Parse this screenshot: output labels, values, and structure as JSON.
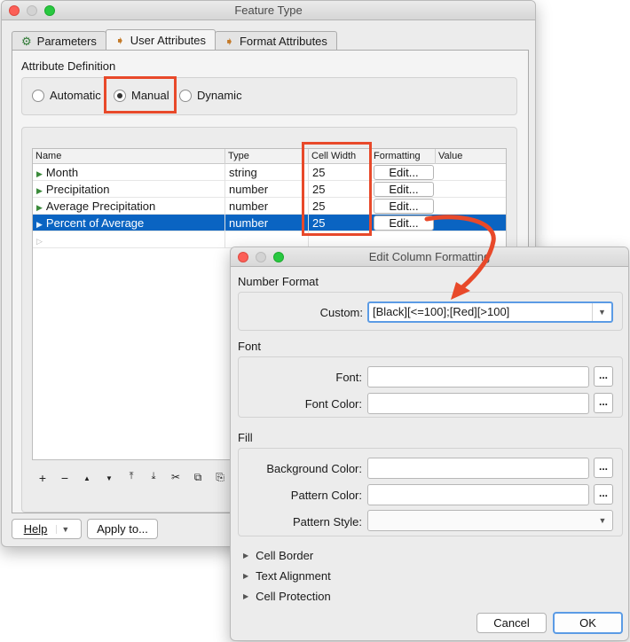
{
  "main_window": {
    "title": "Feature Type",
    "tabs": [
      {
        "label": "Parameters",
        "icon": "gear-icon"
      },
      {
        "label": "User Attributes",
        "icon": "arrow-icon",
        "active": true
      },
      {
        "label": "Format Attributes",
        "icon": "arrow-icon"
      }
    ],
    "attribute_definition_label": "Attribute Definition",
    "radios": [
      {
        "label": "Automatic",
        "checked": false
      },
      {
        "label": "Manual",
        "checked": true
      },
      {
        "label": "Dynamic",
        "checked": false
      }
    ],
    "table": {
      "headers": [
        "Name",
        "Type",
        "Cell Width",
        "Formatting",
        "Value"
      ],
      "rows": [
        {
          "name": "Month",
          "type": "string",
          "cell_width": "25",
          "formatting": "Edit..."
        },
        {
          "name": "Precipitation",
          "type": "number",
          "cell_width": "25",
          "formatting": "Edit..."
        },
        {
          "name": "Average Precipitation",
          "type": "number",
          "cell_width": "25",
          "formatting": "Edit..."
        },
        {
          "name": "Percent of Average",
          "type": "number",
          "cell_width": "25",
          "formatting": "Edit...",
          "selected": true
        }
      ]
    },
    "toolbar": [
      "+",
      "−",
      "▲",
      "▼",
      "⤒",
      "⤓",
      "✂",
      "⧉",
      "⎘"
    ],
    "help_label": "Help",
    "apply_label": "Apply to..."
  },
  "dialog": {
    "title": "Edit Column Formatting",
    "number_format_label": "Number Format",
    "custom_label": "Custom:",
    "custom_value": "[Black][<=100];[Red][>100]",
    "font_section_label": "Font",
    "font_label": "Font:",
    "font_color_label": "Font Color:",
    "fill_section_label": "Fill",
    "background_color_label": "Background Color:",
    "pattern_color_label": "Pattern Color:",
    "pattern_style_label": "Pattern Style:",
    "ellipsis": "...",
    "collapsibles": [
      "Cell Border",
      "Text Alignment",
      "Cell Protection"
    ],
    "cancel_label": "Cancel",
    "ok_label": "OK"
  },
  "colors": {
    "annotation": "#e8492a",
    "selection": "#0a64c2",
    "focus": "#5b9be5"
  }
}
